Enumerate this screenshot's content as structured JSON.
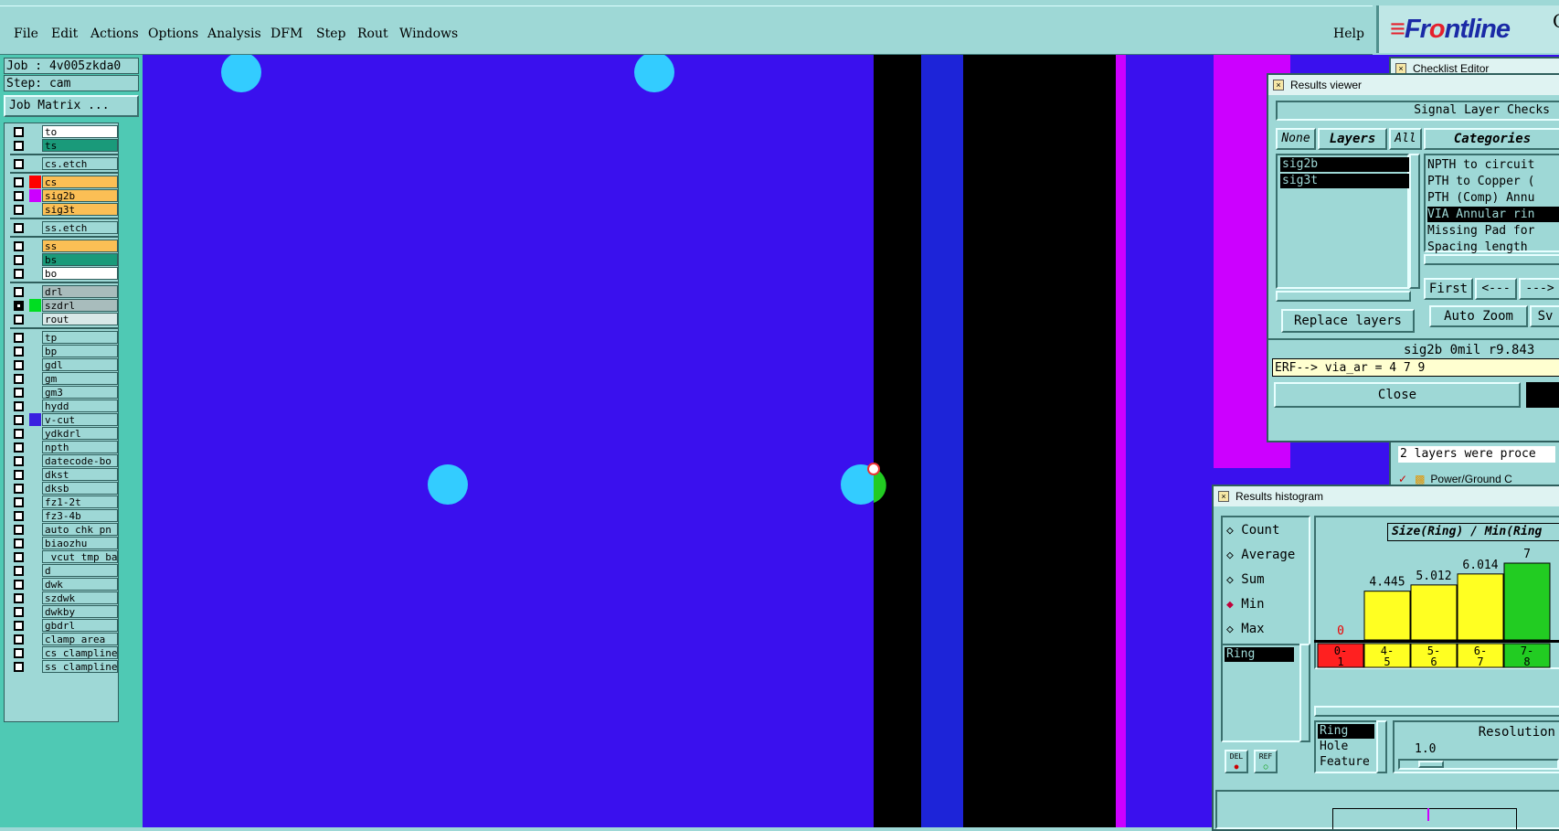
{
  "menu": {
    "items": [
      "File",
      "Edit",
      "Actions",
      "Options",
      "Analysis",
      "DFM",
      "Step",
      "Rout",
      "Windows"
    ],
    "help": "Help"
  },
  "logo": {
    "brand_front": "Fr",
    "brand_o": "o",
    "brand_rest": "ntline",
    "side": "Ge",
    "side2": "G"
  },
  "job": {
    "label": "Job : 4v005zkda0",
    "step": "Step: cam",
    "matrix_button": "Job Matrix ..."
  },
  "layers": [
    {
      "name": "to",
      "color": "#ffffff",
      "sw": ""
    },
    {
      "name": "ts",
      "color": "#1a9a7a",
      "sw": ""
    },
    {
      "name": "cs.etch",
      "color": "#9ed8d6",
      "sw": ""
    },
    {
      "name": "cs",
      "color": "#fbbf55",
      "sw": "#ff0000"
    },
    {
      "name": "sig2b",
      "color": "#fbbf55",
      "sw": "#cc00ff"
    },
    {
      "name": "sig3t",
      "color": "#fbbf55",
      "sw": ""
    },
    {
      "name": "ss.etch",
      "color": "#9ed8d6",
      "sw": ""
    },
    {
      "name": "ss",
      "color": "#fbbf55",
      "sw": ""
    },
    {
      "name": "bs",
      "color": "#1a9a7a",
      "sw": ""
    },
    {
      "name": "bo",
      "color": "#ffffff",
      "sw": ""
    },
    {
      "name": "drl",
      "color": "#a8bcbc",
      "sw": ""
    },
    {
      "name": "szdrl",
      "color": "#a8bcbc",
      "sw": "#00dd22",
      "on": true
    },
    {
      "name": "rout",
      "color": "#d8e8e8",
      "sw": ""
    },
    {
      "name": "tp",
      "color": "#9ed8d6",
      "sw": ""
    },
    {
      "name": "bp",
      "color": "#9ed8d6",
      "sw": ""
    },
    {
      "name": "gdl",
      "color": "#9ed8d6",
      "sw": ""
    },
    {
      "name": "gm",
      "color": "#9ed8d6",
      "sw": ""
    },
    {
      "name": "gm3",
      "color": "#9ed8d6",
      "sw": ""
    },
    {
      "name": "hydd",
      "color": "#9ed8d6",
      "sw": ""
    },
    {
      "name": "v-cut",
      "color": "#9ed8d6",
      "sw": "#3a20e0"
    },
    {
      "name": "ydkdrl",
      "color": "#9ed8d6",
      "sw": ""
    },
    {
      "name": "npth",
      "color": "#9ed8d6",
      "sw": ""
    },
    {
      "name": "datecode-bo",
      "color": "#9ed8d6",
      "sw": ""
    },
    {
      "name": "dkst",
      "color": "#9ed8d6",
      "sw": ""
    },
    {
      "name": "dksb",
      "color": "#9ed8d6",
      "sw": ""
    },
    {
      "name": "fz1-2t",
      "color": "#9ed8d6",
      "sw": ""
    },
    {
      "name": "fz3-4b",
      "color": "#9ed8d6",
      "sw": ""
    },
    {
      "name": "auto_chk_pn",
      "color": "#9ed8d6",
      "sw": ""
    },
    {
      "name": "biaozhu",
      "color": "#9ed8d6",
      "sw": ""
    },
    {
      "name": "_vcut_tmp_ba",
      "color": "#9ed8d6",
      "sw": ""
    },
    {
      "name": "d",
      "color": "#9ed8d6",
      "sw": ""
    },
    {
      "name": "dwk",
      "color": "#9ed8d6",
      "sw": ""
    },
    {
      "name": "szdwk",
      "color": "#9ed8d6",
      "sw": ""
    },
    {
      "name": "dwkby",
      "color": "#9ed8d6",
      "sw": ""
    },
    {
      "name": "gbdrl",
      "color": "#9ed8d6",
      "sw": ""
    },
    {
      "name": "clamp_area",
      "color": "#9ed8d6",
      "sw": ""
    },
    {
      "name": "cs_clampline",
      "color": "#9ed8d6",
      "sw": ""
    },
    {
      "name": "ss_clampline",
      "color": "#9ed8d6",
      "sw": ""
    }
  ],
  "checklist": {
    "title": "Checklist Editor",
    "status": "2 layers were proce",
    "item": "Power/Ground C"
  },
  "results_viewer": {
    "title": "Results viewer",
    "header": "Signal Layer Checks",
    "none": "None",
    "layers": "Layers",
    "all": "All",
    "layer_list": [
      "sig2b",
      "sig3t"
    ],
    "categories_label": "Categories",
    "categories": [
      "NPTH to circuit",
      "PTH to Copper (",
      "PTH (Comp) Annu",
      "VIA Annular rin",
      "Missing Pad for",
      "Spacing length"
    ],
    "first": "First",
    "prev": "<---",
    "next": "--->",
    "auto_zoom": "Auto Zoom",
    "sv": "Sv",
    "replace_layers": "Replace layers",
    "info_line": "sig2b 0mil  r9.843",
    "erf": "ERF--> via_ar = 4 7 9",
    "close": "Close"
  },
  "histogram": {
    "title": "Results histogram",
    "modes": [
      "Count",
      "Average",
      "Sum",
      "Min",
      "Max"
    ],
    "selected_mode": "Min",
    "list_sel": "Ring",
    "chart_title": "Size(Ring) / Min(Ring",
    "del": "DEL",
    "ref": "REF",
    "types": [
      "Ring",
      "Hole",
      "Feature"
    ],
    "resolution_label": "Resolution",
    "resolution_value": "1.0"
  },
  "chart_data": {
    "type": "bar",
    "categories": [
      "0-1",
      "4-5",
      "5-6",
      "6-7",
      "7-8"
    ],
    "values": [
      0,
      4.445,
      5.012,
      6.014,
      7
    ],
    "value_labels": [
      "0",
      "4.445",
      "5.012",
      "6.014",
      "7"
    ],
    "bar_colors": [
      "#ff2020",
      "#ffff22",
      "#ffff22",
      "#ffff22",
      "#22cc22"
    ],
    "title": "Size(Ring) / Min(Ring"
  }
}
